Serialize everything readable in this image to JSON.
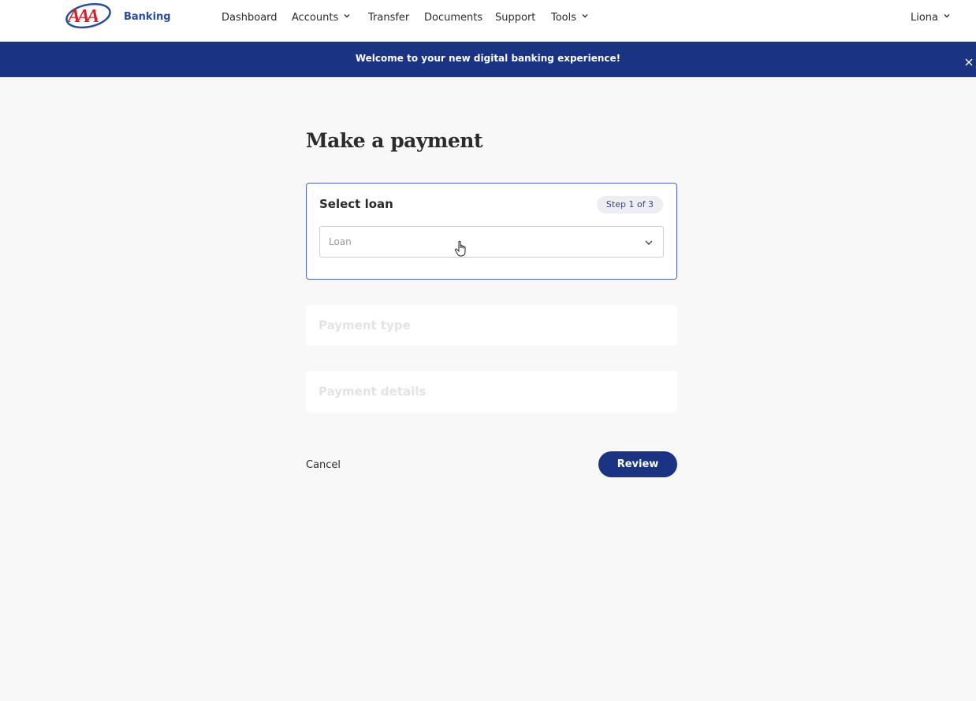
{
  "header": {
    "logo_text": "AAA",
    "brand": "Banking",
    "nav": [
      {
        "label": "Dashboard",
        "has_dropdown": false
      },
      {
        "label": "Accounts",
        "has_dropdown": true
      },
      {
        "label": "Transfer",
        "has_dropdown": false
      },
      {
        "label": "Documents",
        "has_dropdown": false
      },
      {
        "label": "Support",
        "has_dropdown": false
      },
      {
        "label": "Tools",
        "has_dropdown": true
      }
    ],
    "user": "Liona"
  },
  "banner": {
    "message": "Welcome to your new digital banking experience!",
    "close_icon": "close-icon"
  },
  "main": {
    "title": "Make a payment",
    "steps": [
      {
        "title": "Select loan",
        "badge": "Step 1 of 3",
        "active": true,
        "select_placeholder": "Loan"
      },
      {
        "title": "Payment type",
        "active": false
      },
      {
        "title": "Payment details",
        "active": false
      }
    ],
    "cancel_label": "Cancel",
    "review_label": "Review"
  },
  "colors": {
    "primary": "#1a3382",
    "accent_border": "#4a64bf",
    "brand_text": "#2a4d9b",
    "logo_red": "#d6202a",
    "background": "#f8f8f8"
  }
}
